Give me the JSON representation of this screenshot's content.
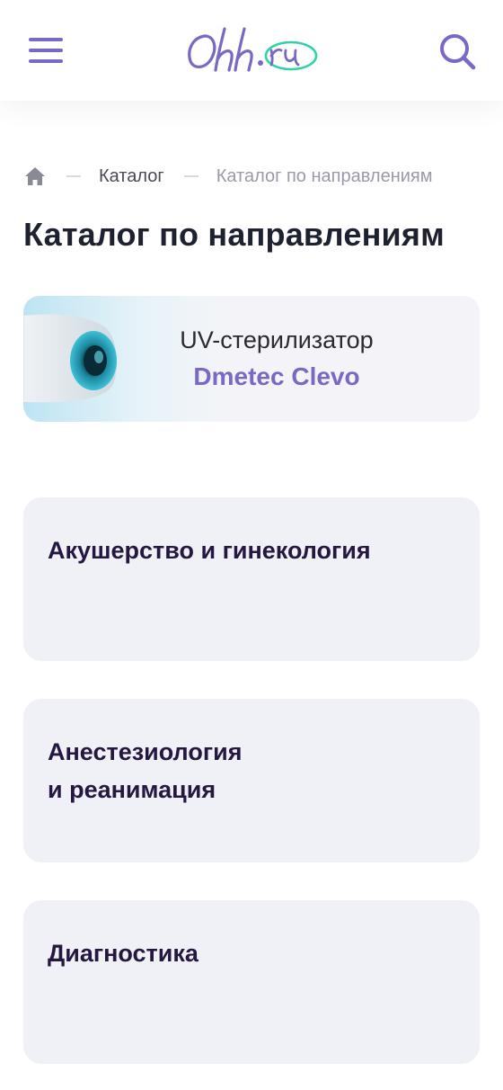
{
  "header": {
    "logo_text": "Ohh.ru",
    "menu_icon": "hamburger-menu-icon",
    "search_icon": "search-icon",
    "accent": "#7b68c4",
    "logo_teal": "#2fd3a8"
  },
  "breadcrumb": {
    "home_icon": "home-icon",
    "items": [
      "Каталог",
      "Каталог по направлениям"
    ]
  },
  "page": {
    "title": "Каталог по направлениям"
  },
  "promo": {
    "line1": "UV-стерилизатор",
    "line2": "Dmetec Clevo"
  },
  "categories": [
    {
      "line1": "Акушерство и гинекология",
      "line2": ""
    },
    {
      "line1": "Анестезиология",
      "line2": "и реанимация"
    },
    {
      "line1": "Диагностика",
      "line2": ""
    }
  ]
}
